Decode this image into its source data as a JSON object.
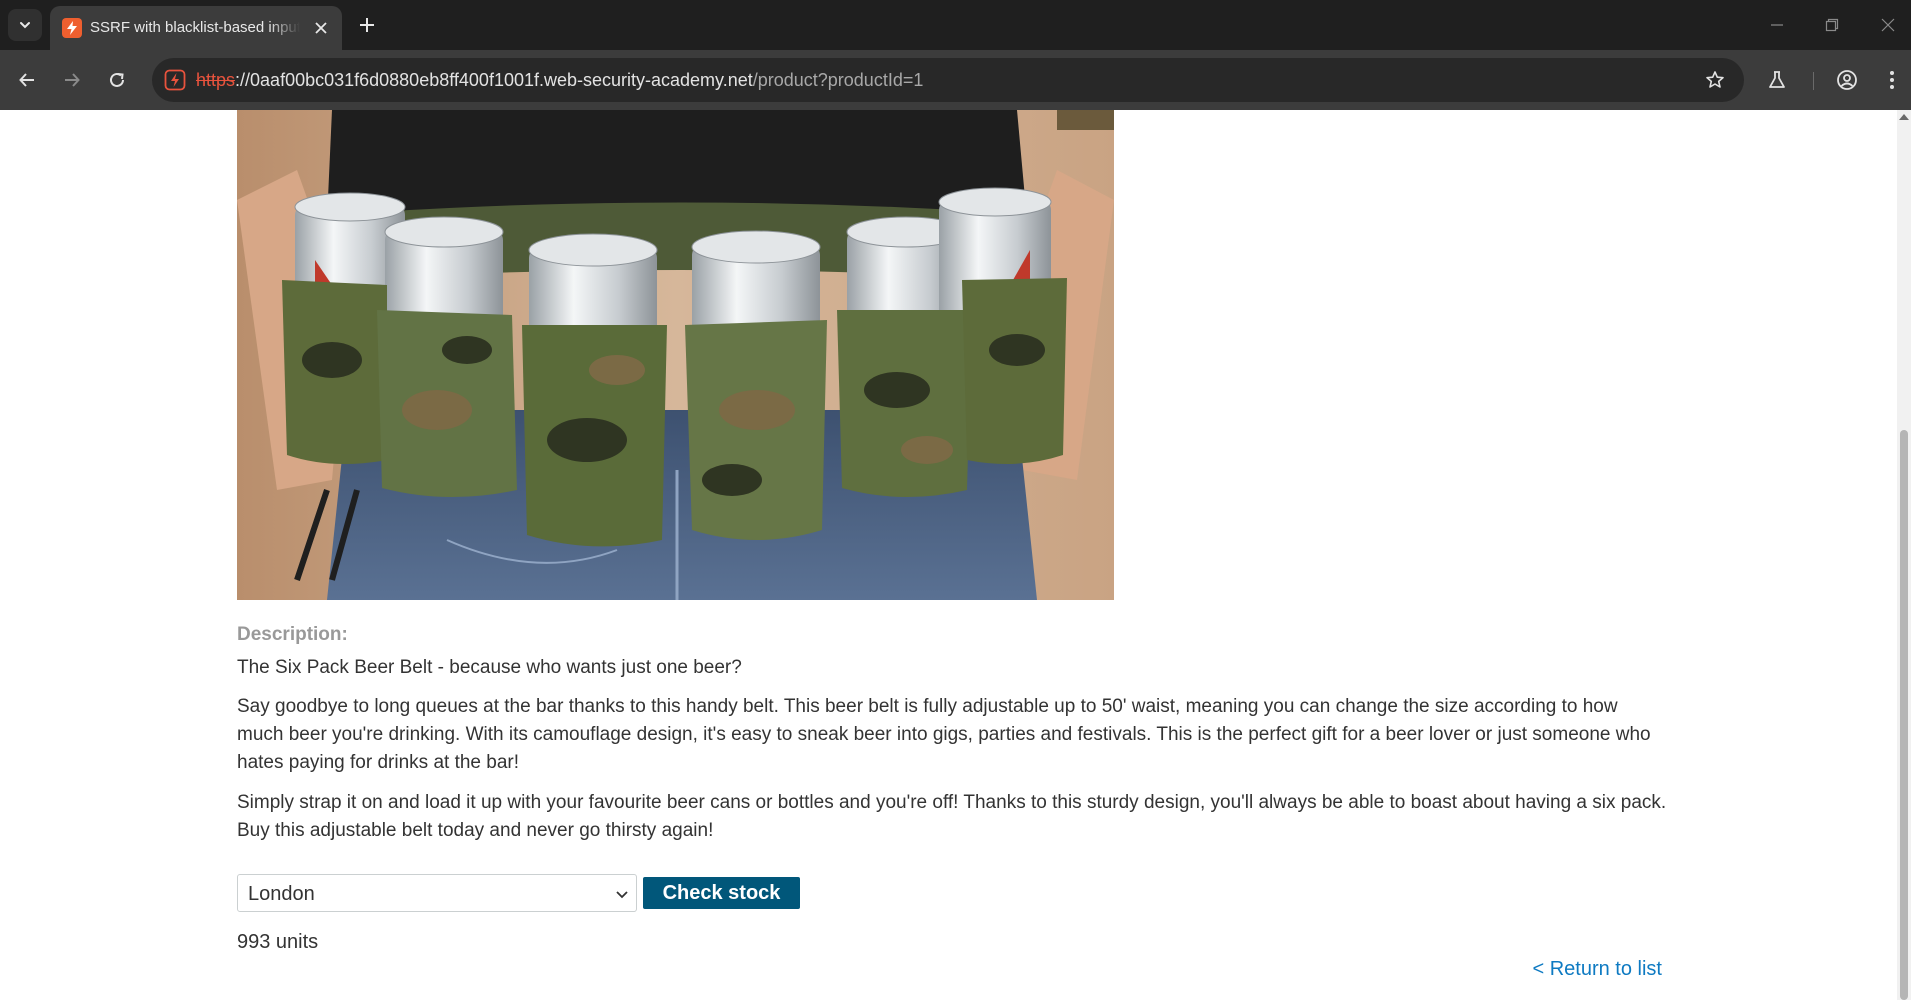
{
  "browser": {
    "tab": {
      "title": "SSRF with blacklist-based input filter"
    },
    "url": {
      "scheme": "https",
      "rest": "://0aaf00bc031f6d0880eb8ff400f1001f.web-security-academy.net",
      "path": "/product?productId=1"
    },
    "colors": {
      "chrome_dark": "#1f1f1f",
      "chrome_mid": "#3c3c3c",
      "favicon": "#ef5f2f",
      "insecure_scheme": "#e8533d"
    }
  },
  "product": {
    "image_icon": "six-pack-beer-belt-photo",
    "description_label": "Description:",
    "tagline": "The Six Pack Beer Belt - because who wants just one beer?",
    "paragraphs": [
      "Say goodbye to long queues at the bar thanks to this handy belt. This beer belt is fully adjustable up to 50' waist, meaning you can change the size according to how much beer you're drinking. With its camouflage design, it's easy to sneak beer into gigs, parties and festivals. This is the perfect gift for a beer lover or just someone who hates paying for drinks at the bar!",
      "Simply strap it on and load it up with your favourite beer cans or bottles and you're off! Thanks to this sturdy design, you'll always be able to boast about having a six pack. Buy this adjustable belt today and never go thirsty again!"
    ]
  },
  "stock": {
    "selected_store": "London",
    "check_button": "Check stock",
    "result": "993 units",
    "button_color": "#01577a"
  },
  "return_link": "< Return to list",
  "link_color": "#0e7ac2"
}
